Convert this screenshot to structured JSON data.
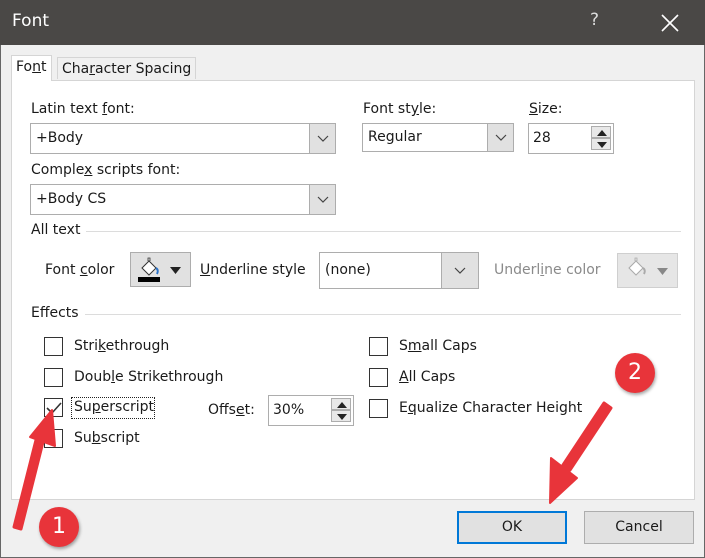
{
  "window": {
    "title": "Font",
    "help_label": "?",
    "close_icon": "close-icon"
  },
  "tabs": [
    {
      "label_pre": "Fo",
      "label_u": "n",
      "label_post": "t",
      "active": true
    },
    {
      "label_pre": "Cha",
      "label_u": "r",
      "label_post": "acter Spacing",
      "active": false
    }
  ],
  "font_section": {
    "latin_label_pre": "Latin text ",
    "latin_label_u": "f",
    "latin_label_post": "ont:",
    "latin_value": "+Body",
    "complex_label_pre": "Comple",
    "complex_label_u": "x",
    "complex_label_post": " scripts font:",
    "complex_value": "+Body CS",
    "style_label_pre": "Font st",
    "style_label_u": "y",
    "style_label_post": "le:",
    "style_value": "Regular",
    "size_label_pre": "",
    "size_label_u": "S",
    "size_label_post": "ize:",
    "size_value": "28"
  },
  "all_text": {
    "heading": "All text",
    "font_color_label_pre": "Font ",
    "font_color_label_u": "c",
    "font_color_label_post": "olor",
    "font_color_swatch": "#000000",
    "underline_style_label_u": "U",
    "underline_style_label_post": "nderline style",
    "underline_style_value": "(none)",
    "underline_color_label_pre": "Underl",
    "underline_color_label_u": "i",
    "underline_color_label_post": "ne color"
  },
  "effects": {
    "heading": "Effects",
    "items_left": [
      {
        "pre": "Stri",
        "u": "k",
        "post": "ethrough",
        "checked": false
      },
      {
        "pre": "Doub",
        "u": "l",
        "post": "e Strikethrough",
        "checked": false
      },
      {
        "pre": "Su",
        "u": "p",
        "post": "erscript",
        "checked": true
      },
      {
        "pre": "Su",
        "u": "b",
        "post": "script",
        "checked": false
      }
    ],
    "items_right": [
      {
        "pre": "S",
        "u": "m",
        "post": "all Caps",
        "checked": false
      },
      {
        "pre": "",
        "u": "A",
        "post": "ll Caps",
        "checked": false
      },
      {
        "pre": "E",
        "u": "q",
        "post": "ualize Character Height",
        "checked": false
      }
    ],
    "offset_label_pre": "Offs",
    "offset_label_u": "e",
    "offset_label_post": "t:",
    "offset_value": "30%"
  },
  "buttons": {
    "ok": "OK",
    "cancel": "Cancel"
  },
  "annotations": {
    "badge1": "1",
    "badge2": "2",
    "color": "#e8343a"
  }
}
